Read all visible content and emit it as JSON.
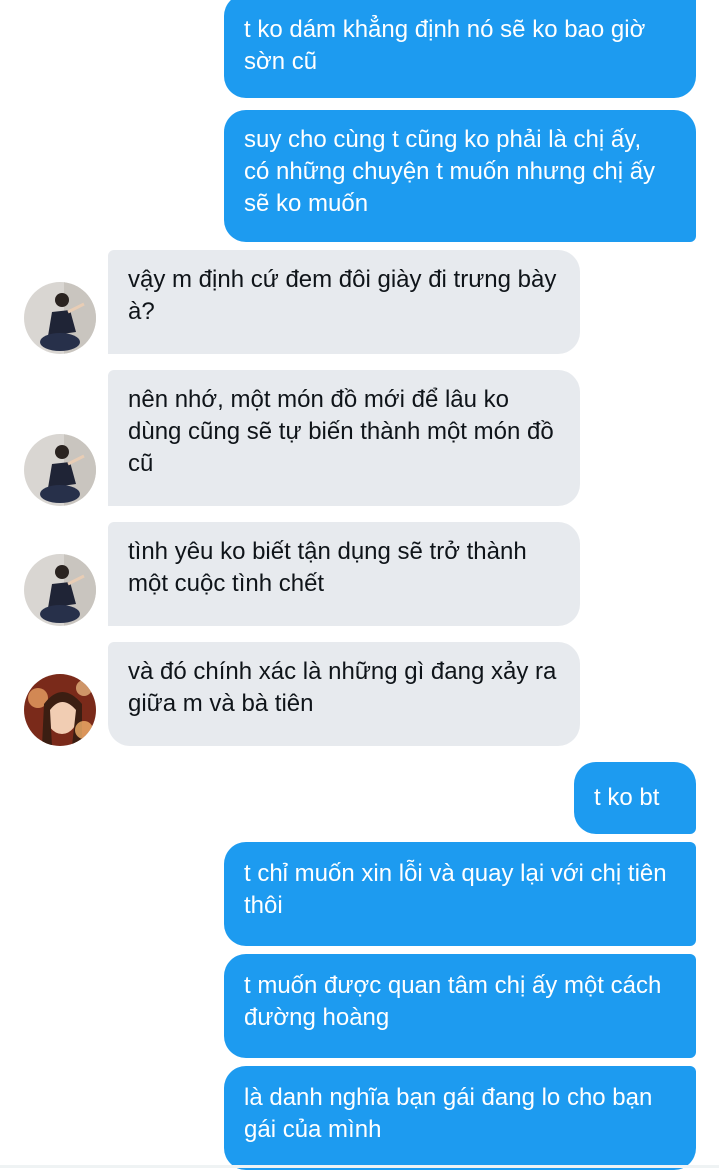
{
  "conversation": {
    "messages": [
      {
        "from": "me",
        "text": "t ko dám khẳng định nó sẽ ko bao giờ sờn cũ"
      },
      {
        "from": "me",
        "text": "suy cho cùng t cũng ko phải là chị ấy, có những chuyện t muốn nhưng chị ấy sẽ ko muốn"
      },
      {
        "from": "them",
        "text": "vậy m định cứ đem đôi giày đi trưng bày à?",
        "avatar": "friend-a-avatar"
      },
      {
        "from": "them",
        "text": "nên nhớ, một món đồ mới để lâu ko dùng cũng sẽ tự biến thành một món đồ cũ",
        "avatar": "friend-a-avatar"
      },
      {
        "from": "them",
        "text": "tình yêu ko biết tận dụng sẽ trở thành một cuộc tình chết",
        "avatar": "friend-a-avatar"
      },
      {
        "from": "them",
        "text": "và đó chính xác là những gì đang xảy ra giữa m và bà tiên",
        "avatar": "friend-b-avatar"
      },
      {
        "from": "me",
        "text": "t ko bt"
      },
      {
        "from": "me",
        "text": "t chỉ muốn xin lỗi và quay lại với chị tiên thôi"
      },
      {
        "from": "me",
        "text": "t muốn được quan tâm chị ấy một cách đường hoàng"
      },
      {
        "from": "me",
        "text": "là danh nghĩa bạn gái đang lo cho bạn gái của mình"
      }
    ]
  },
  "colors": {
    "outgoing_bubble": "#1d9bf0",
    "incoming_bubble": "#e7eaee",
    "outgoing_text": "#ffffff",
    "incoming_text": "#0f1419"
  }
}
